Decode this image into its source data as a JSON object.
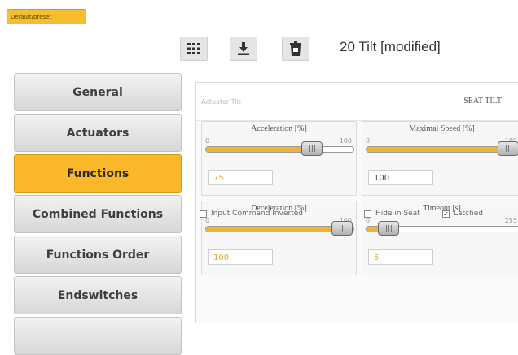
{
  "badge": "Default/preset",
  "toolbar": {
    "title": "20 Tilt [modified]",
    "icons": [
      "grid-icon",
      "download-icon",
      "delete-icon"
    ]
  },
  "nav": {
    "items": [
      {
        "label": "General"
      },
      {
        "label": "Actuators"
      },
      {
        "label": "Functions"
      },
      {
        "label": "Combined Functions"
      },
      {
        "label": "Functions Order"
      },
      {
        "label": "Endswitches"
      }
    ],
    "active": "Functions"
  },
  "panel": {
    "actuator_label": "Actuator Tilt",
    "actuator_value": "SEAT TILT",
    "accel": {
      "label": "Acceleration [%]",
      "min": "0",
      "max": "100",
      "value": "75",
      "level": 0.75
    },
    "maxspeed": {
      "label": "Maximal Speed [%]",
      "min": "0",
      "max": "100",
      "value": "100",
      "level": 1.0
    },
    "decel": {
      "label": "Deceleration [%]",
      "min": "0",
      "max": "100",
      "value": "100",
      "level": 1.0
    },
    "timeout": {
      "label": "Timeout [s]",
      "min": "0",
      "max": "255",
      "value": "5",
      "level": 0.02
    },
    "checks": {
      "input_inverted": "Input Command Inverted",
      "hide_seat": "Hide in Seat",
      "latched": "Latched"
    }
  },
  "colors": {
    "accent": "#fbb82b",
    "slider_fill": "#f2b12e"
  }
}
